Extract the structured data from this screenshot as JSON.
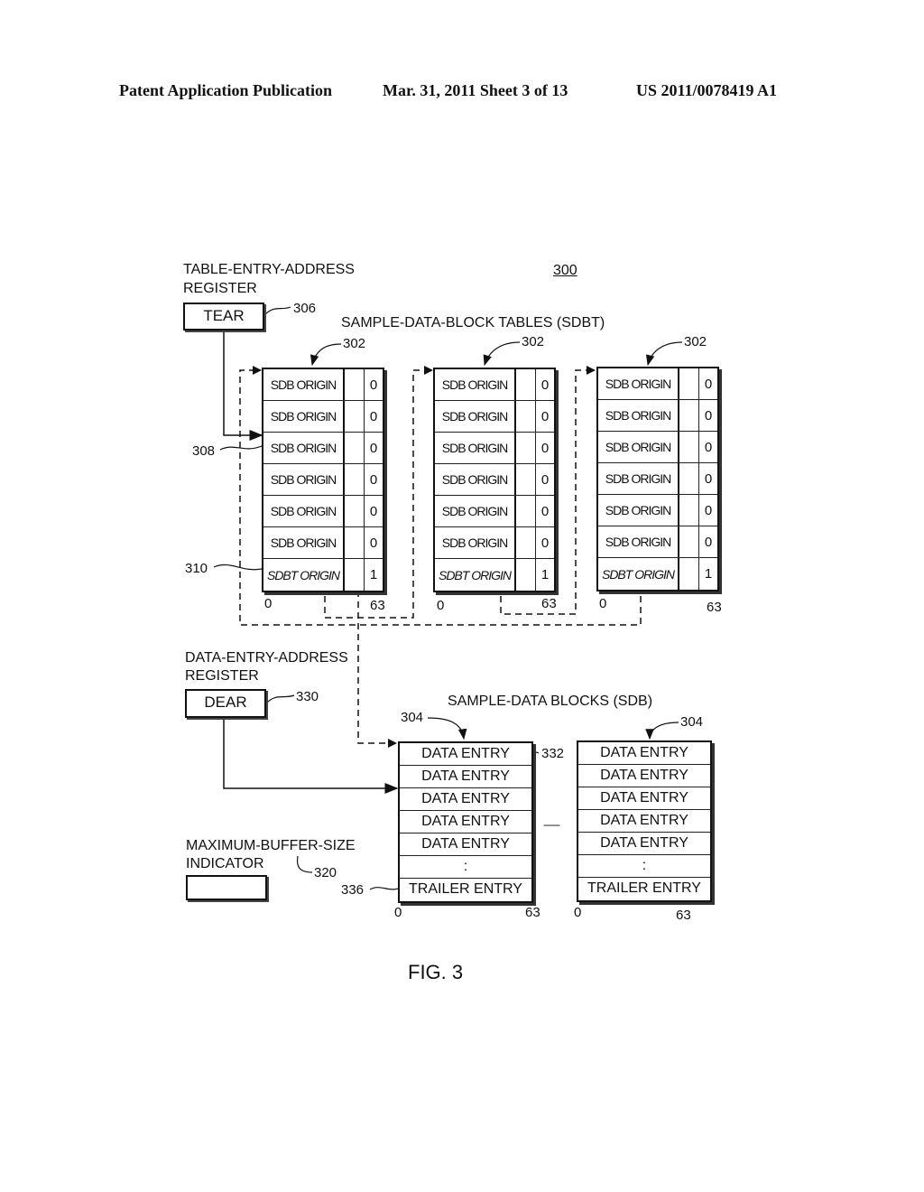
{
  "header": {
    "publication": "Patent Application Publication",
    "date_sheet": "Mar. 31, 2011  Sheet 3 of 13",
    "number": "US 2011/0078419 A1"
  },
  "figure": {
    "ref": "300",
    "caption": "FIG. 3"
  },
  "tear": {
    "title_line1": "TABLE-ENTRY-ADDRESS",
    "title_line2": "REGISTER",
    "box_label": "TEAR",
    "ref": "306"
  },
  "sdbt": {
    "title": "SAMPLE-DATA-BLOCK TABLES (SDBT)",
    "ref": "302",
    "entry_ref": "308",
    "link_ref": "310",
    "bit_start": "0",
    "bit_end": "63",
    "tables": [
      {
        "rows": [
          {
            "label": "SDB ORIGIN",
            "flag": "0"
          },
          {
            "label": "SDB ORIGIN",
            "flag": "0"
          },
          {
            "label": "SDB ORIGIN",
            "flag": "0"
          },
          {
            "label": "SDB ORIGIN",
            "flag": "0"
          },
          {
            "label": "SDB ORIGIN",
            "flag": "0"
          },
          {
            "label": "SDB ORIGIN",
            "flag": "0"
          },
          {
            "label": "SDBT ORIGIN",
            "flag": "1"
          }
        ]
      },
      {
        "rows": [
          {
            "label": "SDB ORIGIN",
            "flag": "0"
          },
          {
            "label": "SDB ORIGIN",
            "flag": "0"
          },
          {
            "label": "SDB ORIGIN",
            "flag": "0"
          },
          {
            "label": "SDB ORIGIN",
            "flag": "0"
          },
          {
            "label": "SDB ORIGIN",
            "flag": "0"
          },
          {
            "label": "SDB ORIGIN",
            "flag": "0"
          },
          {
            "label": "SDBT ORIGIN",
            "flag": "1"
          }
        ]
      },
      {
        "rows": [
          {
            "label": "SDB ORIGIN",
            "flag": "0"
          },
          {
            "label": "SDB ORIGIN",
            "flag": "0"
          },
          {
            "label": "SDB ORIGIN",
            "flag": "0"
          },
          {
            "label": "SDB ORIGIN",
            "flag": "0"
          },
          {
            "label": "SDB ORIGIN",
            "flag": "0"
          },
          {
            "label": "SDB ORIGIN",
            "flag": "0"
          },
          {
            "label": "SDBT ORIGIN",
            "flag": "1"
          }
        ]
      }
    ]
  },
  "dear": {
    "title_line1": "DATA-ENTRY-ADDRESS",
    "title_line2": "REGISTER",
    "box_label": "DEAR",
    "ref": "330"
  },
  "sdb": {
    "title": "SAMPLE-DATA BLOCKS (SDB)",
    "ref": "304",
    "data_entry_ref": "332",
    "trailer_ref": "336",
    "bit_start": "0",
    "bit_end": "63",
    "ellipsis": ":",
    "gap": "------",
    "blocks": [
      {
        "rows": [
          "DATA ENTRY",
          "DATA ENTRY",
          "DATA ENTRY",
          "DATA ENTRY",
          "DATA ENTRY",
          ":",
          "TRAILER ENTRY"
        ]
      },
      {
        "rows": [
          "DATA ENTRY",
          "DATA ENTRY",
          "DATA ENTRY",
          "DATA ENTRY",
          "DATA ENTRY",
          ":",
          "TRAILER ENTRY"
        ]
      }
    ]
  },
  "mbs": {
    "title_line1": "MAXIMUM-BUFFER-SIZE",
    "title_line2": "INDICATOR",
    "ref": "320"
  }
}
